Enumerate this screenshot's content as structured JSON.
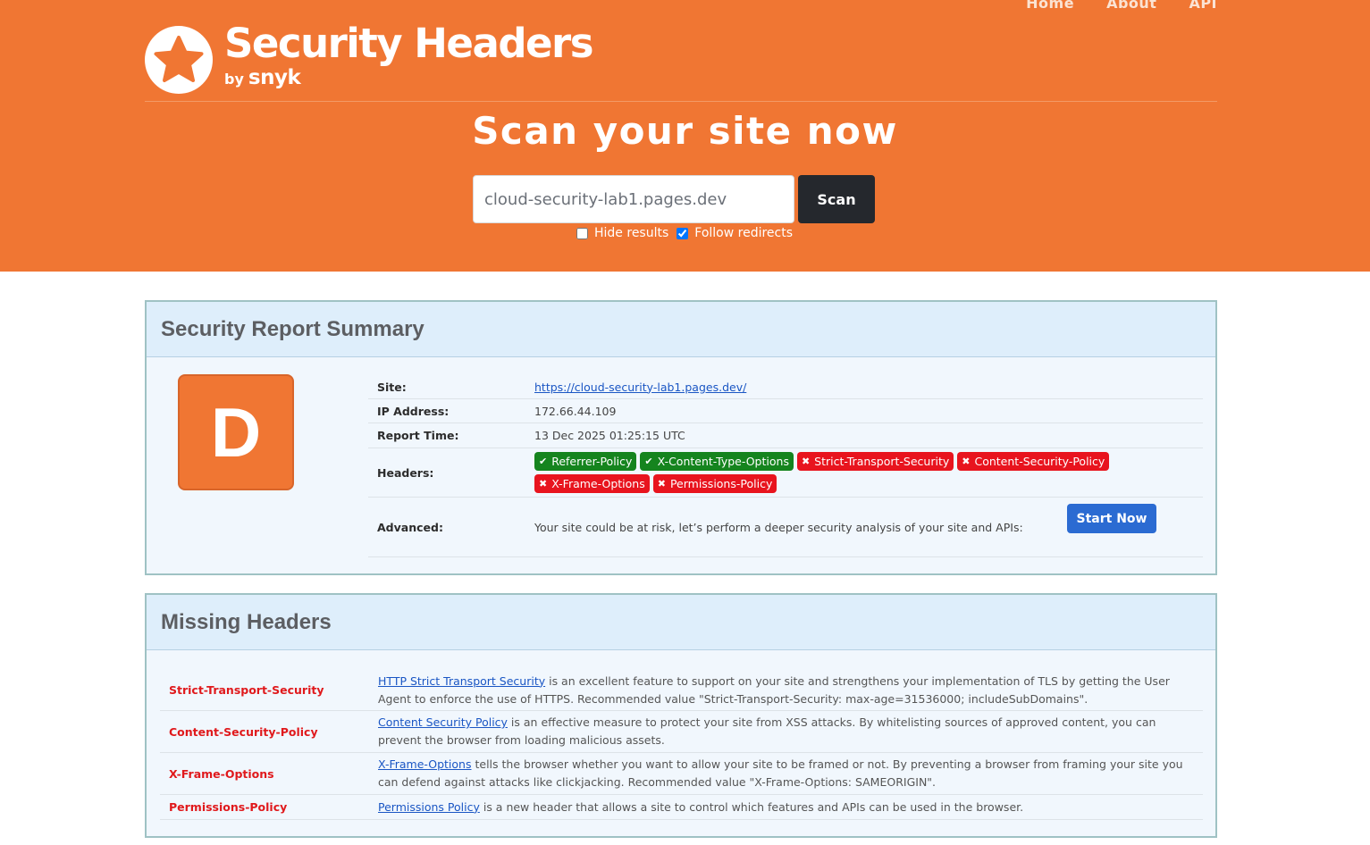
{
  "nav": {
    "home": "Home",
    "about": "About",
    "api": "API"
  },
  "logo": {
    "title": "Security Headers",
    "by": "by",
    "brand": "snyk"
  },
  "hero": {
    "title": "Scan your site now",
    "input_value": "cloud-security-lab1.pages.dev",
    "scan_label": "Scan",
    "hide_results_label": "Hide results",
    "hide_results_checked": false,
    "follow_redirects_label": "Follow redirects",
    "follow_redirects_checked": true
  },
  "summary": {
    "title": "Security Report Summary",
    "grade": "D",
    "site_label": "Site:",
    "site_value": "https://cloud-security-lab1.pages.dev/",
    "ip_label": "IP Address:",
    "ip_value": "172.66.44.109",
    "time_label": "Report Time:",
    "time_value": "13 Dec 2025 01:25:15 UTC",
    "headers_label": "Headers:",
    "headers": [
      {
        "name": "Referrer-Policy",
        "status": "present",
        "icon": "check-icon"
      },
      {
        "name": "X-Content-Type-Options",
        "status": "present",
        "icon": "check-icon"
      },
      {
        "name": "Strict-Transport-Security",
        "status": "missing",
        "icon": "cross-icon"
      },
      {
        "name": "Content-Security-Policy",
        "status": "missing",
        "icon": "cross-icon"
      },
      {
        "name": "X-Frame-Options",
        "status": "missing",
        "icon": "cross-icon"
      },
      {
        "name": "Permissions-Policy",
        "status": "missing",
        "icon": "cross-icon"
      }
    ],
    "advanced_label": "Advanced:",
    "advanced_text": "Your site could be at risk, let’s perform a deeper security analysis of your site and APIs:",
    "start_label": "Start Now"
  },
  "missing": {
    "title": "Missing Headers",
    "items": [
      {
        "name": "Strict-Transport-Security",
        "link": "HTTP Strict Transport Security",
        "text": " is an excellent feature to support on your site and strengthens your implementation of TLS by getting the User Agent to enforce the use of HTTPS. Recommended value \"Strict-Transport-Security: max-age=31536000; includeSubDomains\"."
      },
      {
        "name": "Content-Security-Policy",
        "link": "Content Security Policy",
        "text": " is an effective measure to protect your site from XSS attacks. By whitelisting sources of approved content, you can prevent the browser from loading malicious assets."
      },
      {
        "name": "X-Frame-Options",
        "link": "X-Frame-Options",
        "text": " tells the browser whether you want to allow your site to be framed or not. By preventing a browser from framing your site you can defend against attacks like clickjacking. Recommended value \"X-Frame-Options: SAMEORIGIN\"."
      },
      {
        "name": "Permissions-Policy",
        "link": "Permissions Policy",
        "text": " is a new header that allows a site to control which features and APIs can be used in the browser."
      }
    ]
  },
  "colors": {
    "brand": "#f07633",
    "present": "#15841e",
    "missing": "#e8141e",
    "link": "#1a56c4",
    "start": "#2b6bd2"
  }
}
